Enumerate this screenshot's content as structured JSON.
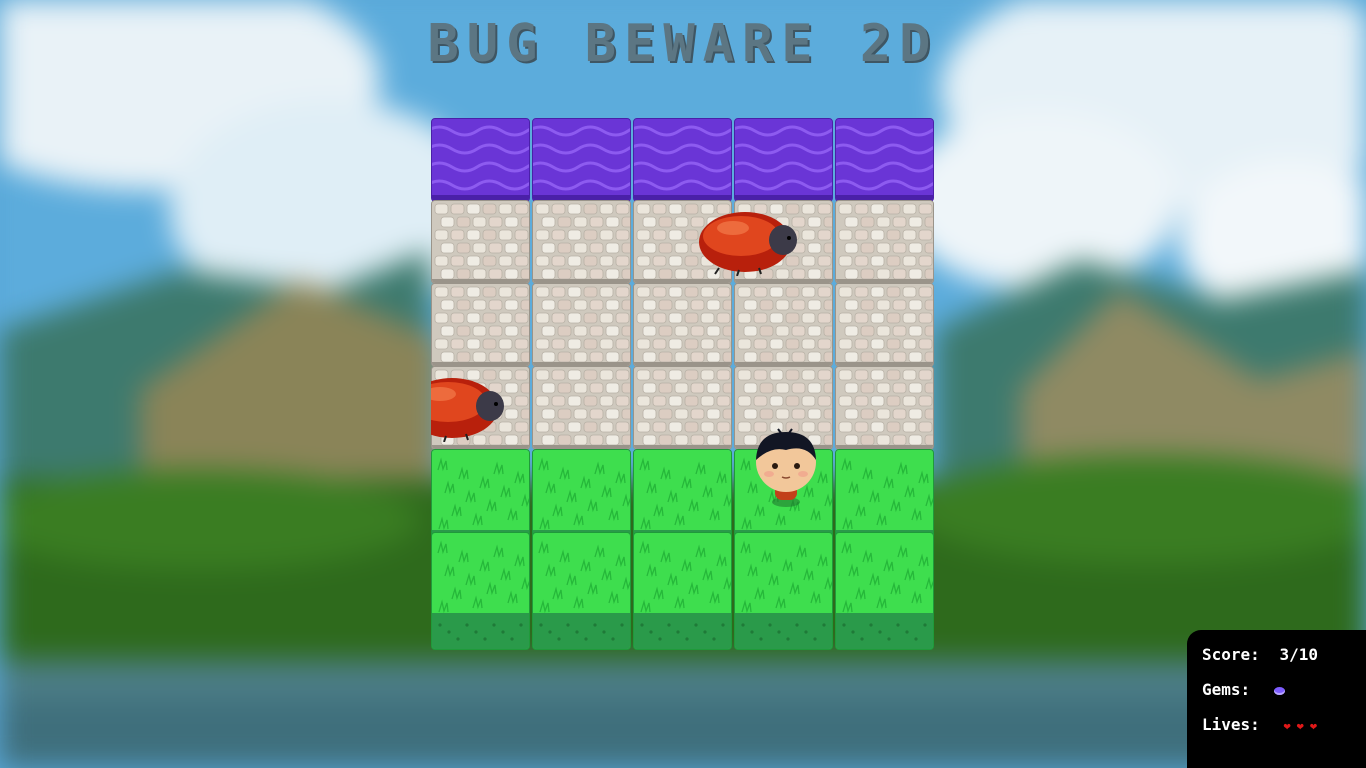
{
  "game": {
    "title": "BUG BEWARE 2D"
  },
  "board": {
    "columns": 5,
    "rows": [
      {
        "type": "water"
      },
      {
        "type": "stone"
      },
      {
        "type": "stone"
      },
      {
        "type": "stone"
      },
      {
        "type": "grass"
      },
      {
        "type": "grass"
      }
    ]
  },
  "entities": [
    {
      "kind": "enemy-bug",
      "icon": "ladybug-icon"
    },
    {
      "kind": "enemy-bug",
      "icon": "ladybug-icon"
    },
    {
      "kind": "player",
      "icon": "boy-character-icon"
    }
  ],
  "hud": {
    "score_label": "Score:",
    "score_value": "3/10",
    "gems_label": "Gems:",
    "gems_icon": "gem-icon",
    "gem_color": "#7d5cff",
    "lives_label": "Lives:",
    "lives_count": 3,
    "heart_color": "#e01818"
  },
  "colors": {
    "water": "#6a35d6",
    "stone": "#d8d3c8",
    "grass": "#3ede4e",
    "title": "#5c7683"
  }
}
